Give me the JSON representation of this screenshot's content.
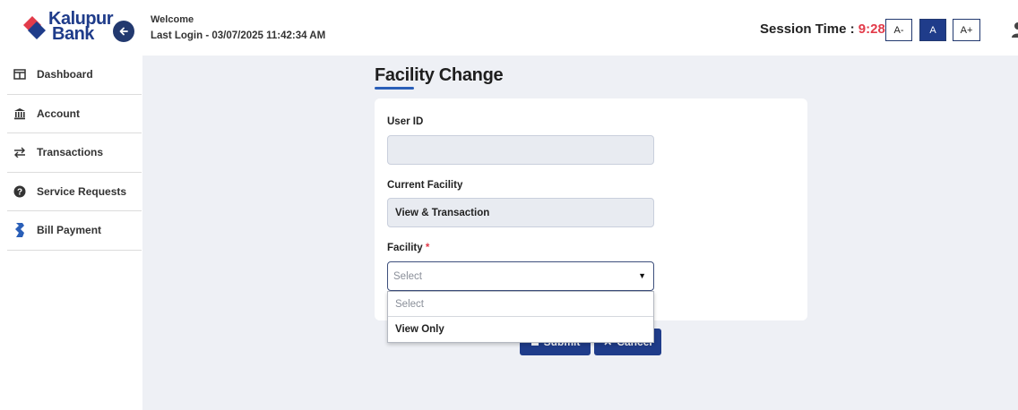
{
  "header": {
    "bank_name_line1": "Kalupur",
    "bank_name_line2": "Bank",
    "welcome": "Welcome",
    "last_login": "Last Login - 03/07/2025 11:42:34 AM",
    "session_label": "Session Time : ",
    "session_time": "9:28",
    "font_buttons": [
      "A-",
      "A",
      "A+"
    ]
  },
  "sidebar": {
    "items": [
      {
        "label": "Dashboard",
        "icon": "dashboard-icon"
      },
      {
        "label": "Account",
        "icon": "bank-icon"
      },
      {
        "label": "Transactions",
        "icon": "transfer-arrows-icon"
      },
      {
        "label": "Service Requests",
        "icon": "help-circle-icon"
      },
      {
        "label": "Bill Payment",
        "icon": "bill-payment-icon"
      }
    ]
  },
  "main": {
    "title": "Facility Change",
    "form": {
      "user_id_label": "User ID",
      "user_id_value": "",
      "current_facility_label": "Current Facility",
      "current_facility_value": "View & Transaction",
      "facility_label": "Facility",
      "facility_required": "*",
      "facility_selected": "Select",
      "facility_options": [
        "Select",
        "View Only"
      ]
    },
    "buttons": {
      "submit": "Submit",
      "cancel": "Cancel"
    }
  },
  "colors": {
    "brand_blue": "#1f3c8a",
    "brand_red": "#e23b4a",
    "accent_underline": "#2a5fb8",
    "content_bg": "#eef0f5"
  }
}
